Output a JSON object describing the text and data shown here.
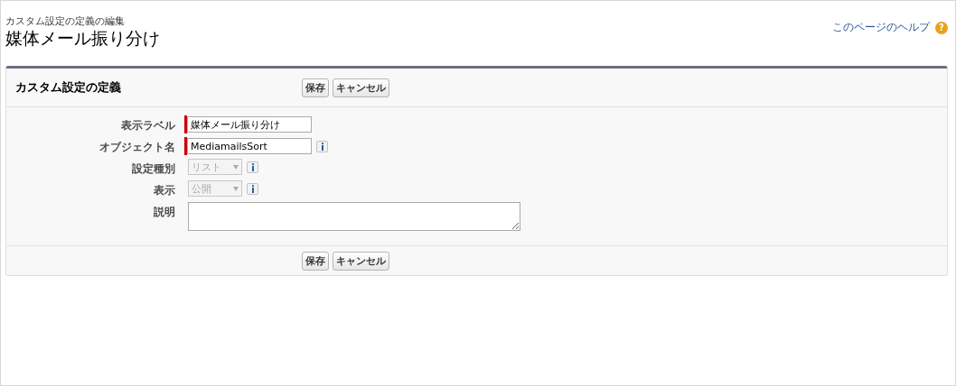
{
  "header": {
    "breadcrumb": "カスタム設定の定義の編集",
    "title": "媒体メール振り分け",
    "help_link": "このページのヘルプ",
    "help_icon": "?"
  },
  "panel": {
    "title": "カスタム設定の定義",
    "buttons": [
      "保存",
      "キャンセル"
    ],
    "fields": [
      {
        "label": "表示ラベル",
        "kind": "text",
        "value": "媒体メール振り分け",
        "required": true,
        "info": false
      },
      {
        "label": "オブジェクト名",
        "kind": "text",
        "value": "MediamailsSort",
        "required": true,
        "info": true
      },
      {
        "label": "設定種別",
        "kind": "select",
        "value": "リスト",
        "disabled": true,
        "info": true
      },
      {
        "label": "表示",
        "kind": "select",
        "value": "公開",
        "disabled": true,
        "info": true
      },
      {
        "label": "説明",
        "kind": "textarea"
      }
    ],
    "bottom_buttons": [
      "保存",
      "キャンセル"
    ]
  }
}
